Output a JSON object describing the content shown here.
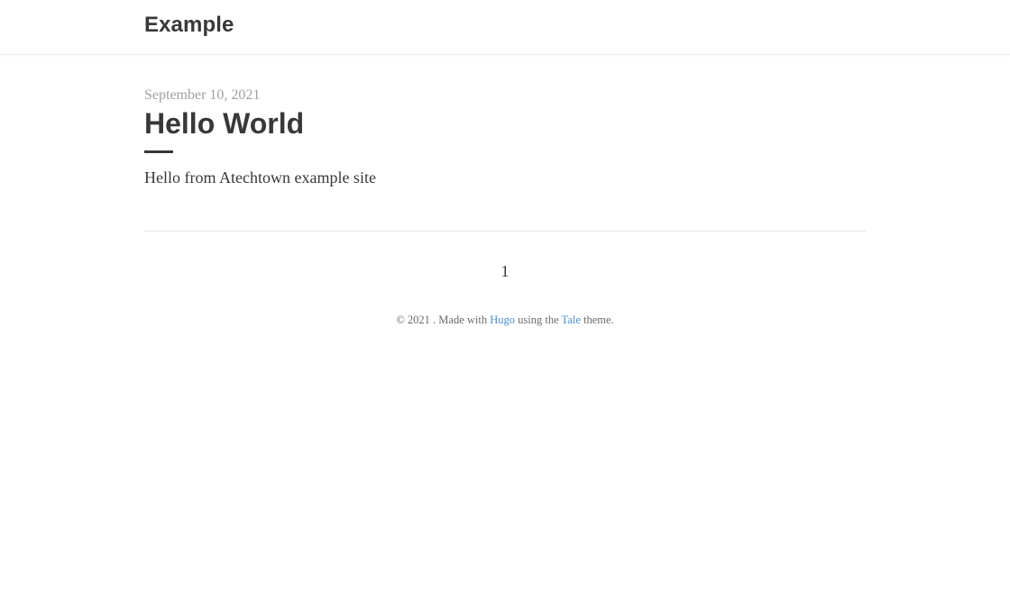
{
  "header": {
    "site_title": "Example"
  },
  "post": {
    "date": "September 10, 2021",
    "title": "Hello World",
    "summary": "Hello from Atechtown example site"
  },
  "pagination": {
    "current_page": "1"
  },
  "footer": {
    "copyright": "© 2021 . Made with",
    "hugo_link": "Hugo",
    "middle_text": "using the",
    "tale_link": "Tale",
    "end_text": "theme."
  },
  "colors": {
    "text": "#383838",
    "muted": "#a0a0a0",
    "link": "#4a8fd0"
  }
}
